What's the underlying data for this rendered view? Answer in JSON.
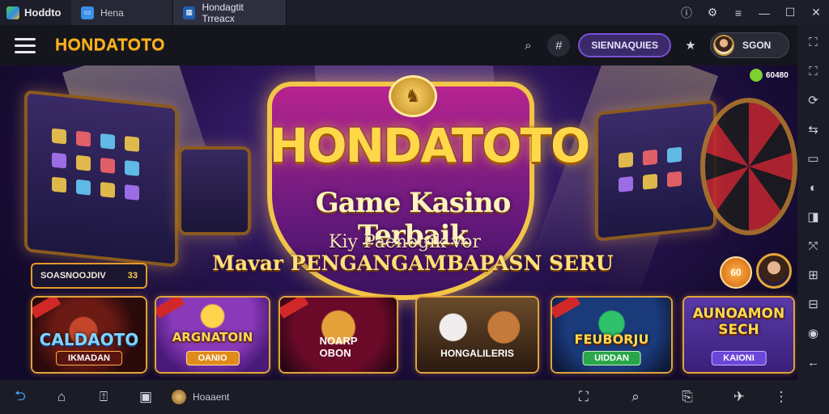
{
  "titlebar": {
    "app_name": "Hoddto",
    "tabs": [
      {
        "label": "Hena"
      },
      {
        "label": "Hondagtit Trreacx"
      }
    ],
    "controls": [
      "help-icon",
      "settings-icon",
      "menu-icon",
      "minimize-icon",
      "maximize-icon",
      "close-icon"
    ]
  },
  "header": {
    "brand": "HONDATOTO",
    "promo_button": "SIENNAQUIES",
    "user_button": "SGON"
  },
  "banner": {
    "title": "HONDATOTO",
    "subtitle": "Game Kasino Terbaik",
    "line1": "Kiy Paenogik vor",
    "line2": "Mavar PENGANGAMBAPASN SERU",
    "corner_badge": "60480",
    "balance_label": "SOASNOOJDIV",
    "balance_value": "33",
    "round_badge": "60"
  },
  "games": [
    {
      "title": "CALDAOTO",
      "button": "IKMADAN"
    },
    {
      "title": "ARGNATOIN",
      "button": "OANIO"
    },
    {
      "title": "",
      "button": "NOARP OBON"
    },
    {
      "title": "",
      "button": "HONGALILERIS"
    },
    {
      "title": "FEUBORJU",
      "button": "UIDDAN"
    },
    {
      "title": "AUNOAMON SECH",
      "button": "KAIONI"
    }
  ],
  "bottombar": {
    "app_label": "Hoaaent"
  }
}
